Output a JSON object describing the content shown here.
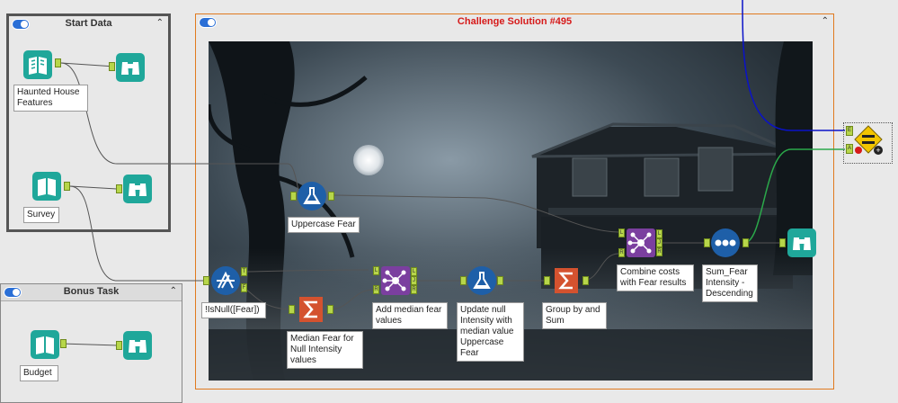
{
  "start_container": {
    "title": "Start Data"
  },
  "bonus_container": {
    "title": "Bonus Task"
  },
  "solution_container": {
    "title": "Challenge Solution #495"
  },
  "tools": {
    "haunted_input": {
      "label": "Haunted House Features"
    },
    "survey_input": {
      "label": "Survey"
    },
    "budget_input": {
      "label": "Budget"
    },
    "uppercase_formula": {
      "label": "Uppercase Fear"
    },
    "isnull_filter": {
      "label": "!IsNull([Fear])"
    },
    "median_summarize": {
      "label": "Median Fear for Null Intensity values"
    },
    "add_median_join": {
      "label": "Add median fear values"
    },
    "update_null_formula": {
      "label": "Update null Intensity with median value Uppercase Fear"
    },
    "group_sum": {
      "label": "Group by and Sum"
    },
    "combine_join": {
      "label": "Combine costs with Fear results"
    },
    "sort_tool": {
      "label": "Sum_Fear Intensity - Descending"
    }
  },
  "anchors": {
    "true": "T",
    "false": "F",
    "left": "L",
    "join": "J",
    "right": "R",
    "expected": "E",
    "actual": "A"
  },
  "colors": {
    "accent_orange": "#e07a1f",
    "title_red": "#d61a1a",
    "input_teal": "#1fa79a",
    "join_purple": "#7b3f9f",
    "formula_blue": "#1e5fa8",
    "summarize_orange": "#d4522f",
    "connection_blue": "#0a12c8",
    "connection_green": "#2ba84a"
  },
  "icons": [
    "book-input-icon",
    "binoculars-browse-icon",
    "flask-formula-icon",
    "filter-icon",
    "sigma-summarize-icon",
    "join-icon",
    "sort-icon",
    "test-equal-icon"
  ]
}
